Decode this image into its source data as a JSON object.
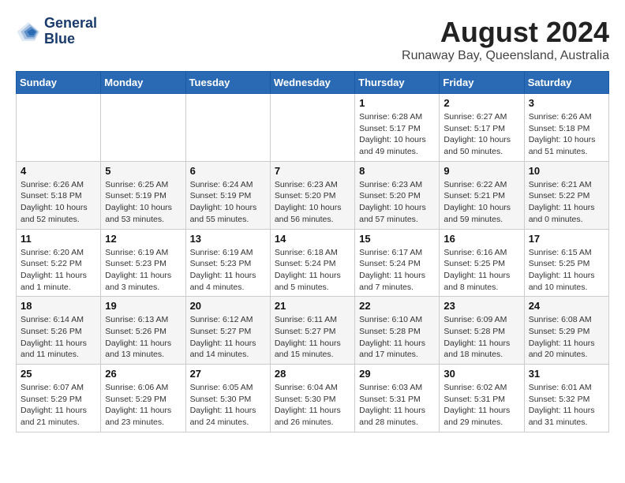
{
  "header": {
    "logo_line1": "General",
    "logo_line2": "Blue",
    "month_year": "August 2024",
    "location": "Runaway Bay, Queensland, Australia"
  },
  "weekdays": [
    "Sunday",
    "Monday",
    "Tuesday",
    "Wednesday",
    "Thursday",
    "Friday",
    "Saturday"
  ],
  "weeks": [
    [
      {
        "day": "",
        "info": ""
      },
      {
        "day": "",
        "info": ""
      },
      {
        "day": "",
        "info": ""
      },
      {
        "day": "",
        "info": ""
      },
      {
        "day": "1",
        "info": "Sunrise: 6:28 AM\nSunset: 5:17 PM\nDaylight: 10 hours\nand 49 minutes."
      },
      {
        "day": "2",
        "info": "Sunrise: 6:27 AM\nSunset: 5:17 PM\nDaylight: 10 hours\nand 50 minutes."
      },
      {
        "day": "3",
        "info": "Sunrise: 6:26 AM\nSunset: 5:18 PM\nDaylight: 10 hours\nand 51 minutes."
      }
    ],
    [
      {
        "day": "4",
        "info": "Sunrise: 6:26 AM\nSunset: 5:18 PM\nDaylight: 10 hours\nand 52 minutes."
      },
      {
        "day": "5",
        "info": "Sunrise: 6:25 AM\nSunset: 5:19 PM\nDaylight: 10 hours\nand 53 minutes."
      },
      {
        "day": "6",
        "info": "Sunrise: 6:24 AM\nSunset: 5:19 PM\nDaylight: 10 hours\nand 55 minutes."
      },
      {
        "day": "7",
        "info": "Sunrise: 6:23 AM\nSunset: 5:20 PM\nDaylight: 10 hours\nand 56 minutes."
      },
      {
        "day": "8",
        "info": "Sunrise: 6:23 AM\nSunset: 5:20 PM\nDaylight: 10 hours\nand 57 minutes."
      },
      {
        "day": "9",
        "info": "Sunrise: 6:22 AM\nSunset: 5:21 PM\nDaylight: 10 hours\nand 59 minutes."
      },
      {
        "day": "10",
        "info": "Sunrise: 6:21 AM\nSunset: 5:22 PM\nDaylight: 11 hours\nand 0 minutes."
      }
    ],
    [
      {
        "day": "11",
        "info": "Sunrise: 6:20 AM\nSunset: 5:22 PM\nDaylight: 11 hours\nand 1 minute."
      },
      {
        "day": "12",
        "info": "Sunrise: 6:19 AM\nSunset: 5:23 PM\nDaylight: 11 hours\nand 3 minutes."
      },
      {
        "day": "13",
        "info": "Sunrise: 6:19 AM\nSunset: 5:23 PM\nDaylight: 11 hours\nand 4 minutes."
      },
      {
        "day": "14",
        "info": "Sunrise: 6:18 AM\nSunset: 5:24 PM\nDaylight: 11 hours\nand 5 minutes."
      },
      {
        "day": "15",
        "info": "Sunrise: 6:17 AM\nSunset: 5:24 PM\nDaylight: 11 hours\nand 7 minutes."
      },
      {
        "day": "16",
        "info": "Sunrise: 6:16 AM\nSunset: 5:25 PM\nDaylight: 11 hours\nand 8 minutes."
      },
      {
        "day": "17",
        "info": "Sunrise: 6:15 AM\nSunset: 5:25 PM\nDaylight: 11 hours\nand 10 minutes."
      }
    ],
    [
      {
        "day": "18",
        "info": "Sunrise: 6:14 AM\nSunset: 5:26 PM\nDaylight: 11 hours\nand 11 minutes."
      },
      {
        "day": "19",
        "info": "Sunrise: 6:13 AM\nSunset: 5:26 PM\nDaylight: 11 hours\nand 13 minutes."
      },
      {
        "day": "20",
        "info": "Sunrise: 6:12 AM\nSunset: 5:27 PM\nDaylight: 11 hours\nand 14 minutes."
      },
      {
        "day": "21",
        "info": "Sunrise: 6:11 AM\nSunset: 5:27 PM\nDaylight: 11 hours\nand 15 minutes."
      },
      {
        "day": "22",
        "info": "Sunrise: 6:10 AM\nSunset: 5:28 PM\nDaylight: 11 hours\nand 17 minutes."
      },
      {
        "day": "23",
        "info": "Sunrise: 6:09 AM\nSunset: 5:28 PM\nDaylight: 11 hours\nand 18 minutes."
      },
      {
        "day": "24",
        "info": "Sunrise: 6:08 AM\nSunset: 5:29 PM\nDaylight: 11 hours\nand 20 minutes."
      }
    ],
    [
      {
        "day": "25",
        "info": "Sunrise: 6:07 AM\nSunset: 5:29 PM\nDaylight: 11 hours\nand 21 minutes."
      },
      {
        "day": "26",
        "info": "Sunrise: 6:06 AM\nSunset: 5:29 PM\nDaylight: 11 hours\nand 23 minutes."
      },
      {
        "day": "27",
        "info": "Sunrise: 6:05 AM\nSunset: 5:30 PM\nDaylight: 11 hours\nand 24 minutes."
      },
      {
        "day": "28",
        "info": "Sunrise: 6:04 AM\nSunset: 5:30 PM\nDaylight: 11 hours\nand 26 minutes."
      },
      {
        "day": "29",
        "info": "Sunrise: 6:03 AM\nSunset: 5:31 PM\nDaylight: 11 hours\nand 28 minutes."
      },
      {
        "day": "30",
        "info": "Sunrise: 6:02 AM\nSunset: 5:31 PM\nDaylight: 11 hours\nand 29 minutes."
      },
      {
        "day": "31",
        "info": "Sunrise: 6:01 AM\nSunset: 5:32 PM\nDaylight: 11 hours\nand 31 minutes."
      }
    ]
  ]
}
